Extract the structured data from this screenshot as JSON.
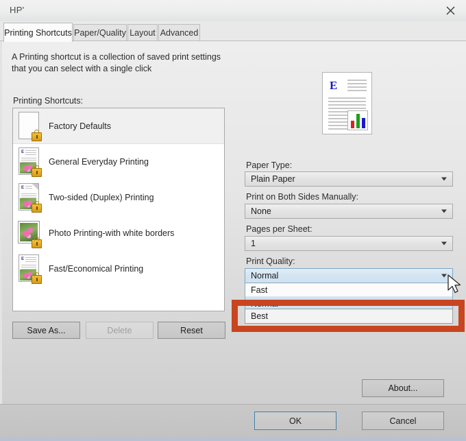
{
  "window": {
    "title": "HP'",
    "close_icon": "close-icon"
  },
  "tabs": [
    {
      "label": "Printing Shortcuts",
      "active": true
    },
    {
      "label": "Paper/Quality",
      "active": false
    },
    {
      "label": "Layout",
      "active": false
    },
    {
      "label": "Advanced",
      "active": false
    }
  ],
  "description": "A Printing shortcut is a collection of saved print settings that you can select with a single click",
  "shortcuts": {
    "label": "Printing Shortcuts:",
    "items": [
      {
        "label": "Factory Defaults",
        "selected": true,
        "icon": "blank-page-locked-icon"
      },
      {
        "label": "General Everyday Printing",
        "selected": false,
        "icon": "document-photo-locked-icon"
      },
      {
        "label": "Two-sided (Duplex) Printing",
        "selected": false,
        "icon": "duplex-document-locked-icon"
      },
      {
        "label": "Photo Printing-with white borders",
        "selected": false,
        "icon": "photo-locked-icon"
      },
      {
        "label": "Fast/Economical Printing",
        "selected": false,
        "icon": "document-photo-locked-icon"
      }
    ]
  },
  "list_buttons": {
    "save_as": "Save As...",
    "delete": "Delete",
    "delete_disabled": true,
    "reset": "Reset"
  },
  "preview": {
    "letter": "E",
    "chart_bar_colors": [
      "#e02020",
      "#1aa11a",
      "#1818d0"
    ]
  },
  "settings": {
    "paper_type": {
      "label": "Paper Type:",
      "value": "Plain Paper"
    },
    "both_sides": {
      "label": "Print on Both Sides Manually:",
      "value": "None"
    },
    "pages_per_sheet": {
      "label": "Pages per Sheet:",
      "value": "1"
    },
    "print_quality": {
      "label": "Print Quality:",
      "value": "Normal",
      "open": true,
      "options": [
        {
          "label": "Fast",
          "highlighted": false
        },
        {
          "label": "Normal",
          "highlighted": true
        },
        {
          "label": "Best",
          "highlighted": false,
          "annotated": true
        }
      ]
    }
  },
  "about_button": "About...",
  "footer": {
    "ok": "OK",
    "cancel": "Cancel"
  },
  "annotation": {
    "color": "#c8451f",
    "target": "Best"
  }
}
